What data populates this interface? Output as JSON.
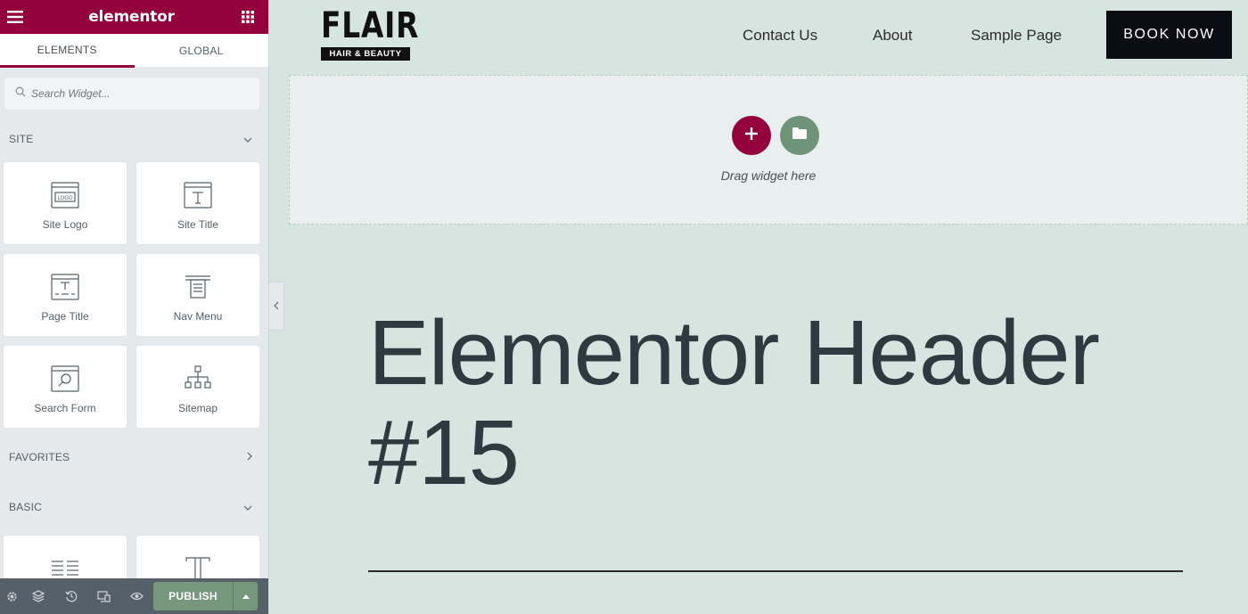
{
  "sidebar": {
    "brand": "elementor",
    "tabs": [
      {
        "label": "ELEMENTS",
        "active": true
      },
      {
        "label": "GLOBAL",
        "active": false
      }
    ],
    "search_placeholder": "Search Widget...",
    "sections": {
      "site": {
        "title": "SITE",
        "widgets": [
          {
            "label": "Site Logo",
            "icon": "site-logo-icon"
          },
          {
            "label": "Site Title",
            "icon": "site-title-icon"
          },
          {
            "label": "Page Title",
            "icon": "page-title-icon"
          },
          {
            "label": "Nav Menu",
            "icon": "nav-menu-icon"
          },
          {
            "label": "Search Form",
            "icon": "search-form-icon"
          },
          {
            "label": "Sitemap",
            "icon": "sitemap-icon"
          }
        ]
      },
      "favorites": {
        "title": "FAVORITES"
      },
      "basic": {
        "title": "BASIC",
        "widgets": [
          {
            "icon": "text-columns-icon"
          },
          {
            "icon": "heading-icon"
          }
        ]
      }
    },
    "footer": {
      "publish_label": "PUBLISH"
    }
  },
  "site_header": {
    "logo_title": "FLAIR",
    "logo_subtitle": "HAIR & BEAUTY",
    "nav": [
      "Contact Us",
      "About",
      "Sample Page"
    ],
    "cta": "BOOK NOW"
  },
  "dropzone": {
    "hint": "Drag widget here"
  },
  "headline": "Elementor Header #15",
  "colors": {
    "brand": "#93003c",
    "canvas_bg": "#d6e5e0",
    "publish": "#76977b",
    "cta_bg": "#0c0c14"
  }
}
